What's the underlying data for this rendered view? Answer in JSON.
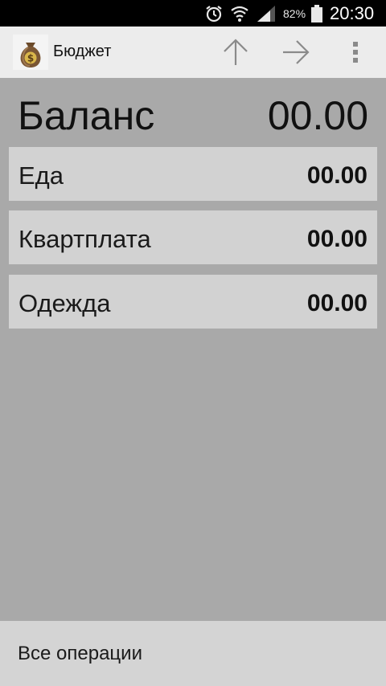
{
  "status_bar": {
    "battery_percent": "82%",
    "time": "20:30",
    "icons": [
      "alarm-icon",
      "wifi-icon",
      "signal-icon",
      "battery-icon"
    ]
  },
  "action_bar": {
    "title": "Бюджет",
    "logo_icon": "money-bag-icon",
    "buttons": [
      "arrow-up-icon",
      "arrow-right-icon",
      "overflow-menu-icon"
    ]
  },
  "balance": {
    "label": "Баланс",
    "value": "00.00"
  },
  "categories": [
    {
      "name": "Еда",
      "amount": "00.00"
    },
    {
      "name": "Квартплата",
      "amount": "00.00"
    },
    {
      "name": "Одежда",
      "amount": "00.00"
    }
  ],
  "bottom": {
    "label": "Все операции"
  },
  "colors": {
    "background": "#a9a9a9",
    "row": "#d2d2d2",
    "action_bar": "#ececec",
    "status_bar": "#000000"
  }
}
